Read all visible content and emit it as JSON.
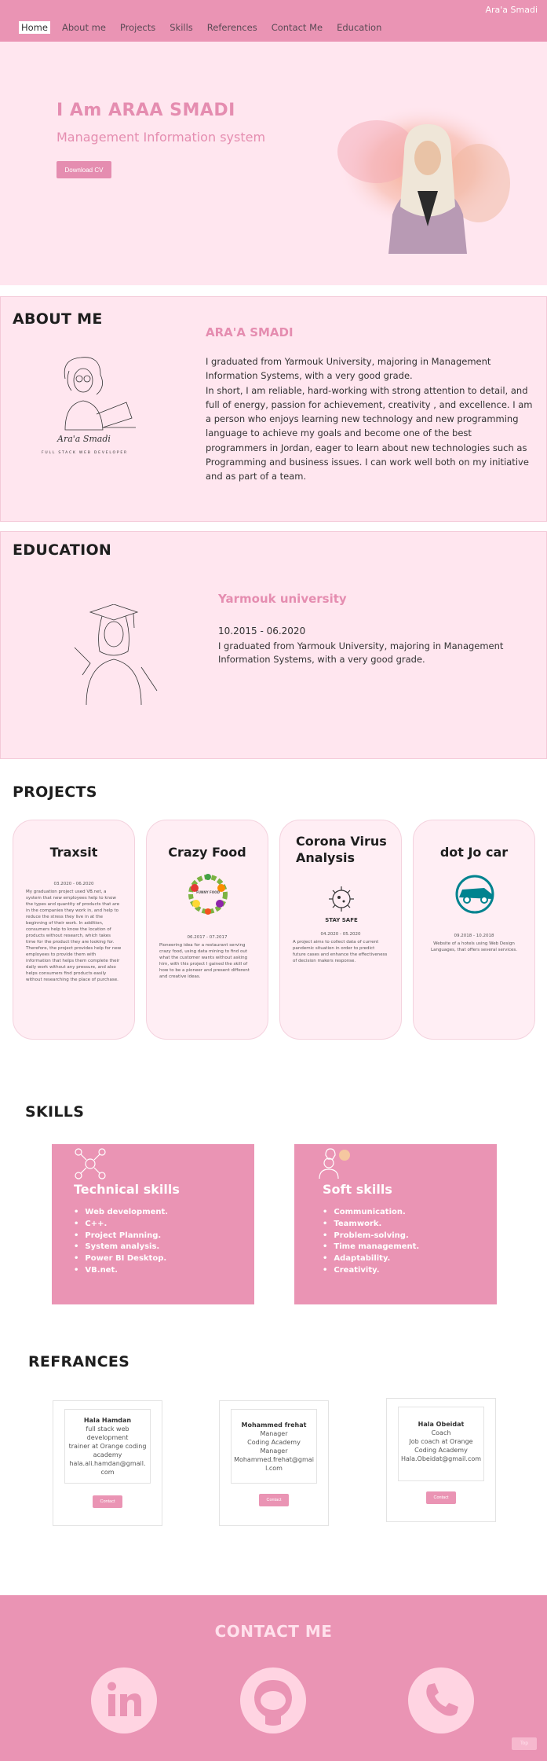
{
  "nav": {
    "brand": "Ara'a Smadi",
    "links": [
      "Home",
      "About me",
      "Projects",
      "Skills",
      "References",
      "Contact Me",
      "Education"
    ]
  },
  "hero": {
    "title": "I Am ARAA  SMADI",
    "subtitle": "Management Information system",
    "button": "Download CV"
  },
  "about": {
    "heading": "ABOUT ME",
    "name": "ARA'A SMADI",
    "para1": "I graduated from Yarmouk University, majoring in Management Information Systems, with a very good grade.",
    "para2": "In short, I am reliable, hard-working with strong attention to detail, and full of energy, passion for achievement, creativity , and excellence. I am a person who enjoys learning new technology and new programming language to achieve my goals and become one of the best programmers in Jordan, eager to learn about new technologies such as Programming and business issues. I can work well both on my initiative and as part of a team.",
    "signature": "Ara'a Smadi",
    "illus_caption": "FULL STACK WEB DEVELOPER"
  },
  "education": {
    "heading": "EDUCATION",
    "university": "Yarmouk university",
    "dates": "10.2015 - 06.2020",
    "text": "I graduated from Yarmouk University, majoring in Management Information Systems, with a very good grade."
  },
  "projects": {
    "heading": "PROJECTS",
    "items": [
      {
        "title": "Traxsit",
        "date": "03.2020 - 06.2020",
        "text": "My graduation project used VB.net, a system that new employees help to know the types and quantity of products that are in the companies they work in, and help to reduce the stress they live in at the beginning of their work. In addition, consumers help to know the location of products without research, which takes time for the product they are looking for. Therefore, the project provides help for new employees to provide them with information that helps them complete their daily work without any pressure, and also helps consumers find products easily without researching the place of purchase."
      },
      {
        "title": "Crazy Food",
        "date": "06.2017 - 07.2017",
        "text": "Pioneering idea for a restaurant serving crazy food, using data mining to find out what the customer wants without asking him, with this project I gained the skill of how to be a pioneer and present different and creative ideas.",
        "icon_text": "FUNNY FOOD"
      },
      {
        "title": "Corona Virus Analysis",
        "date": "04.2020 - 05.2020",
        "text": "A project aims to collect data of current pandemic situation in order to predict future cases and enhance the effectiveness of decision makers response.",
        "icon_text": "STAY SAFE"
      },
      {
        "title": "dot Jo car",
        "date": "09.2018 - 10.2018",
        "text": "Website of a hotels using Web Design Languages, that offers several services."
      }
    ]
  },
  "skills": {
    "heading": "SKILLS",
    "technical": {
      "title": "Technical skills",
      "items": [
        "Web development.",
        "C++.",
        "Project Planning.",
        "System analysis.",
        "Power BI Desktop.",
        "VB.net."
      ]
    },
    "soft": {
      "title": "Soft skills",
      "items": [
        "Communication.",
        "Teamwork.",
        "Problem-solving.",
        "Time management.",
        "Adaptability.",
        "Creativity."
      ]
    }
  },
  "references": {
    "heading": "REFRANCES",
    "items": [
      {
        "name": "Hala Hamdan",
        "lines": [
          "full stack web",
          "development",
          "trainer at Orange coding",
          "academy",
          "hala.ali.hamdan@gmail.",
          "com"
        ],
        "button": "Contact"
      },
      {
        "name": "Mohammed frehat",
        "lines": [
          "Manager",
          "Coding Academy",
          "Manager",
          "Mohammed.frehat@gmai",
          "l.com"
        ],
        "button": "Contact"
      },
      {
        "name": "Hala Obeidat",
        "lines": [
          "Coach",
          "Job coach at Orange",
          "Coding Academy",
          "Hala.Obeidat@gmail.com"
        ],
        "button": "Contact"
      }
    ]
  },
  "contact": {
    "heading": "CONTACT ME",
    "icons": [
      "linkedin-icon",
      "github-icon",
      "phone-icon"
    ]
  },
  "misc": {
    "top_button": "Top"
  },
  "colors": {
    "accent": "#ea94b4",
    "title_pink": "#e58db0",
    "section_bg": "#ffe6ef"
  }
}
